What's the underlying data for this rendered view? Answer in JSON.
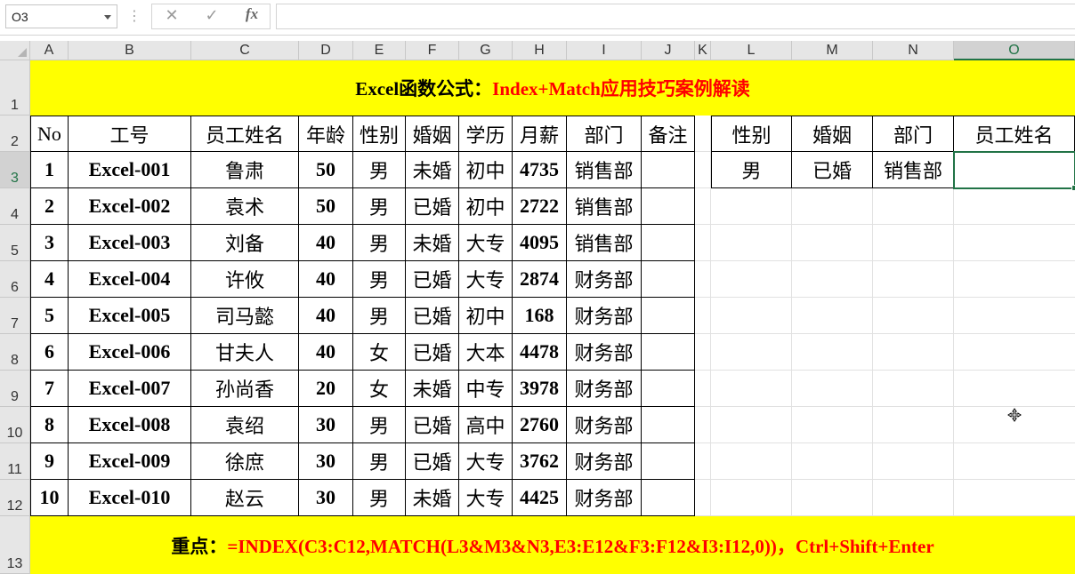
{
  "formula_bar": {
    "name_box": "O3",
    "formula": "",
    "icons": [
      "more-options-icon",
      "cancel-icon",
      "enter-icon",
      "insert-function-icon"
    ]
  },
  "columns": [
    "A",
    "B",
    "C",
    "D",
    "E",
    "F",
    "G",
    "H",
    "I",
    "J",
    "K",
    "L",
    "M",
    "N",
    "O"
  ],
  "rows": [
    "1",
    "2",
    "3",
    "4",
    "5",
    "6",
    "7",
    "8",
    "9",
    "10",
    "11",
    "12",
    "13"
  ],
  "selected": {
    "column": "O",
    "row": "3"
  },
  "title": {
    "part1": "Excel函数公式：",
    "part2": "Index+Match应用技巧案例解读"
  },
  "table": {
    "headers": [
      "No",
      "工号",
      "员工姓名",
      "年龄",
      "性别",
      "婚姻",
      "学历",
      "月薪",
      "部门",
      "备注"
    ],
    "rows": [
      [
        "1",
        "Excel-001",
        "鲁肃",
        "50",
        "男",
        "未婚",
        "初中",
        "4735",
        "销售部",
        ""
      ],
      [
        "2",
        "Excel-002",
        "袁术",
        "50",
        "男",
        "已婚",
        "初中",
        "2722",
        "销售部",
        ""
      ],
      [
        "3",
        "Excel-003",
        "刘备",
        "40",
        "男",
        "未婚",
        "大专",
        "4095",
        "销售部",
        ""
      ],
      [
        "4",
        "Excel-004",
        "许攸",
        "40",
        "男",
        "已婚",
        "大专",
        "2874",
        "财务部",
        ""
      ],
      [
        "5",
        "Excel-005",
        "司马懿",
        "40",
        "男",
        "已婚",
        "初中",
        "168",
        "财务部",
        ""
      ],
      [
        "6",
        "Excel-006",
        "甘夫人",
        "40",
        "女",
        "已婚",
        "大本",
        "4478",
        "财务部",
        ""
      ],
      [
        "7",
        "Excel-007",
        "孙尚香",
        "20",
        "女",
        "未婚",
        "中专",
        "3978",
        "财务部",
        ""
      ],
      [
        "8",
        "Excel-008",
        "袁绍",
        "30",
        "男",
        "已婚",
        "高中",
        "2760",
        "财务部",
        ""
      ],
      [
        "9",
        "Excel-009",
        "徐庶",
        "30",
        "男",
        "已婚",
        "大专",
        "3762",
        "财务部",
        ""
      ],
      [
        "10",
        "Excel-010",
        "赵云",
        "30",
        "男",
        "未婚",
        "大专",
        "4425",
        "财务部",
        ""
      ]
    ]
  },
  "query": {
    "headers": [
      "性别",
      "婚姻",
      "部门",
      "员工姓名"
    ],
    "values": [
      "男",
      "已婚",
      "销售部",
      ""
    ]
  },
  "note": {
    "label": "重点：",
    "formula": "=INDEX(C3:C12,MATCH(L3&M3&N3,E3:E12&F3:F12&I3:I12,0))，Ctrl+Shift+Enter"
  },
  "colors": {
    "banner": "#ffff00",
    "title_red": "#ff0000",
    "excel_green": "#217346"
  }
}
